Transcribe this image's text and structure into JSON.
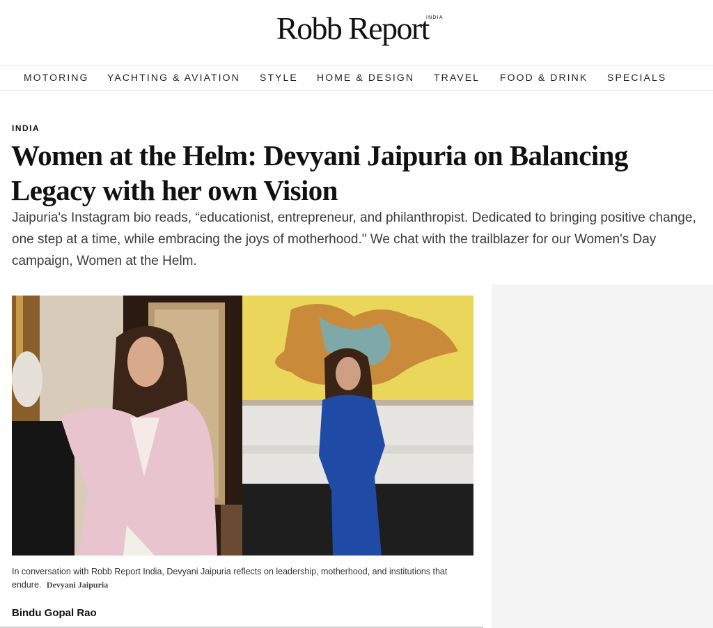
{
  "header": {
    "logo_main": "Robb Report",
    "logo_sub": "INDIA"
  },
  "nav": {
    "items": [
      {
        "label": "MOTORING"
      },
      {
        "label": "YACHTING & AVIATION"
      },
      {
        "label": "STYLE"
      },
      {
        "label": "HOME & DESIGN"
      },
      {
        "label": "TRAVEL"
      },
      {
        "label": "FOOD & DRINK"
      },
      {
        "label": "SPECIALS"
      }
    ]
  },
  "article": {
    "category": "INDIA",
    "title": "Women at the Helm: Devyani Jaipuria on Balancing Legacy with her own Vision",
    "dek": "Jaipuria's Instagram bio reads, “educationist, entrepreneur, and philanthropist. Dedicated to bringing positive change, one step at a time, while embracing the joys of motherhood.\" We chat with the trailblazer for our Women's Day campaign, Women at the Helm.",
    "caption": "In conversation with Robb Report India, Devyani Jaipuria reflects on leadership, motherhood, and institutions that endure.",
    "photo_credit": "Devyani Jaipuria",
    "author": "Bindu Gopal Rao"
  },
  "colors": {
    "text": "#111111",
    "nav_border": "#e2e2e2",
    "blazer_pink": "#e8c4cf",
    "suit_blue": "#1f4aa6",
    "painting_yellow": "#e9d65a"
  }
}
